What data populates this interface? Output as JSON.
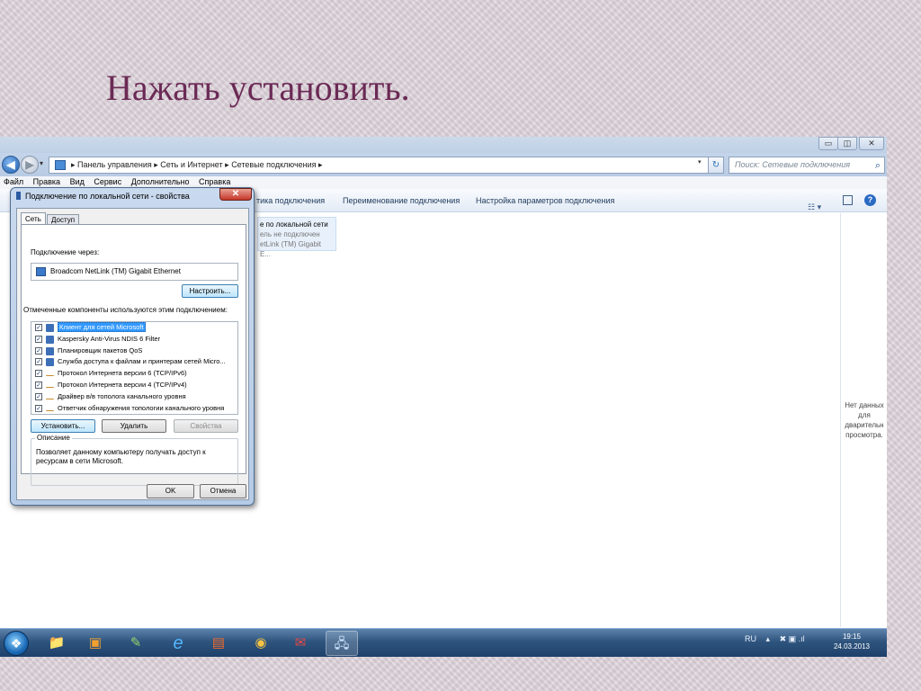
{
  "slide": {
    "title": "Нажать установить."
  },
  "explorer": {
    "window_buttons": [
      "▭",
      "◫",
      "✕"
    ],
    "nav": {
      "back": "◀",
      "forward": "▶",
      "dropdown": "▾",
      "refresh": "↻"
    },
    "breadcrumb": [
      "Панель управления",
      "Сеть и Интернет",
      "Сетевые подключения"
    ],
    "breadcrumb_separator": "▸",
    "search_placeholder": "Поиск: Сетевые подключения",
    "menu": [
      "Файл",
      "Правка",
      "Вид",
      "Сервис",
      "Дополнительно",
      "Справка"
    ],
    "commands": [
      "тика подключения",
      "Переименование подключения",
      "Настройка параметров подключения"
    ],
    "view_button": "☷ ▾",
    "help": "?",
    "connection": {
      "line1": "е по локальной сети",
      "line2": "ель не подключен",
      "line3": "etLink (TM) Gigabit E..."
    },
    "preview_text": "Нет данных для дварительн просмотра."
  },
  "dialog": {
    "title": "Подключение по локальной сети - свойства",
    "close": "✕",
    "tabs": [
      "Сеть",
      "Доступ"
    ],
    "connect_using_label": "Подключение через:",
    "adapter": "Broadcom NetLink (TM) Gigabit Ethernet",
    "configure_button": "Настроить...",
    "components_label": "Отмеченные компоненты используются этим подключением:",
    "components": [
      {
        "label": "Клиент для сетей Microsoft",
        "checked": true,
        "selected": true,
        "icon": "client-icon"
      },
      {
        "label": "Kaspersky Anti-Virus NDIS 6 Filter",
        "checked": true,
        "selected": false,
        "icon": "service-icon"
      },
      {
        "label": "Планировщик пакетов QoS",
        "checked": true,
        "selected": false,
        "icon": "service-icon"
      },
      {
        "label": "Служба доступа к файлам и принтерам сетей Micro...",
        "checked": true,
        "selected": false,
        "icon": "service-icon"
      },
      {
        "label": "Протокол Интернета версии 6 (TCP/IPv6)",
        "checked": true,
        "selected": false,
        "icon": "protocol-icon"
      },
      {
        "label": "Протокол Интернета версии 4 (TCP/IPv4)",
        "checked": true,
        "selected": false,
        "icon": "protocol-icon"
      },
      {
        "label": "Драйвер в/в тополога канального уровня",
        "checked": true,
        "selected": false,
        "icon": "protocol-icon"
      },
      {
        "label": "Ответчик обнаружения топологии канального уровня",
        "checked": true,
        "selected": false,
        "icon": "protocol-icon"
      }
    ],
    "checkmark": "✓",
    "install_button": "Установить...",
    "uninstall_button": "Удалить",
    "properties_button": "Свойства",
    "description_label": "Описание",
    "description_text": "Позволяет данному компьютеру получать доступ к ресурсам в сети Microsoft.",
    "ok_button": "OK",
    "cancel_button": "Отмена"
  },
  "taskbar": {
    "start": "❖",
    "apps": [
      {
        "name": "explorer-icon",
        "glyph": "📁",
        "active": false
      },
      {
        "name": "media-player-icon",
        "glyph": "▣",
        "active": false
      },
      {
        "name": "paint-icon",
        "glyph": "✎",
        "active": false
      },
      {
        "name": "internet-explorer-icon",
        "glyph": "e",
        "active": false
      },
      {
        "name": "presentation-icon",
        "glyph": "▤",
        "active": false
      },
      {
        "name": "chrome-icon",
        "glyph": "◉",
        "active": false
      },
      {
        "name": "pdf-icon",
        "glyph": "✉",
        "active": false
      },
      {
        "name": "network-connections-icon",
        "glyph": "🖧",
        "active": true
      }
    ],
    "tray": {
      "lang": "RU",
      "expand": "▴",
      "icons": "✖ ▣ .ıl"
    },
    "time": "19:15",
    "date": "24.03.2013"
  }
}
